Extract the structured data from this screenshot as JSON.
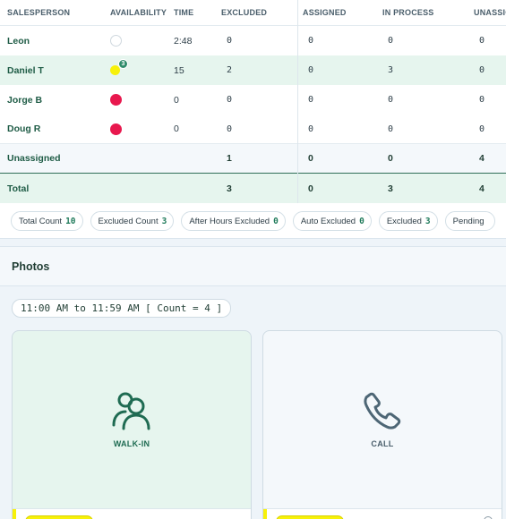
{
  "table": {
    "headers": {
      "salesperson": "SALESPERSON",
      "availability": "AVAILABILITY",
      "time": "TIME",
      "excluded": "EXCLUDED",
      "assigned": "ASSIGNED",
      "in_process": "IN PROCESS",
      "unassigned": "UNASSIGNED"
    },
    "rows": [
      {
        "name": "Leon",
        "availability": "empty",
        "time": "2:48",
        "excluded": "0",
        "assigned": "0",
        "in_process": "0",
        "unassigned": "0"
      },
      {
        "name": "Daniel T",
        "availability": "yellow",
        "badge": "3",
        "time": "15",
        "excluded": "2",
        "assigned": "0",
        "in_process": "3",
        "unassigned": "0"
      },
      {
        "name": "Jorge B",
        "availability": "red",
        "time": "0",
        "excluded": "0",
        "assigned": "0",
        "in_process": "0",
        "unassigned": "0"
      },
      {
        "name": "Doug R",
        "availability": "red",
        "time": "0",
        "excluded": "0",
        "assigned": "0",
        "in_process": "0",
        "unassigned": "0"
      }
    ],
    "unassigned_row": {
      "name": "Unassigned",
      "excluded": "1",
      "assigned": "0",
      "in_process": "0",
      "unassigned": "4"
    },
    "total_row": {
      "name": "Total",
      "excluded": "3",
      "assigned": "0",
      "in_process": "3",
      "unassigned": "4"
    }
  },
  "chips": [
    {
      "label": "Total Count",
      "value": "10"
    },
    {
      "label": "Excluded Count",
      "value": "3"
    },
    {
      "label": "After Hours Excluded",
      "value": "0"
    },
    {
      "label": "Auto Excluded",
      "value": "0"
    },
    {
      "label": "Excluded",
      "value": "3"
    },
    {
      "label": "Pending",
      "value": ""
    }
  ],
  "photos": {
    "title": "Photos",
    "time_range": "11:00 AM to 11:59 AM [ Count = 4 ]",
    "tiles": [
      {
        "label": "WALK-IN",
        "icon": "walk-in-people-icon"
      },
      {
        "label": "CALL",
        "icon": "phone-icon"
      }
    ]
  },
  "colors": {
    "accent_green": "#1f6b52",
    "zebra": "#e6f5ee",
    "status_red": "#e8184e",
    "status_yellow": "#f7f10a"
  }
}
